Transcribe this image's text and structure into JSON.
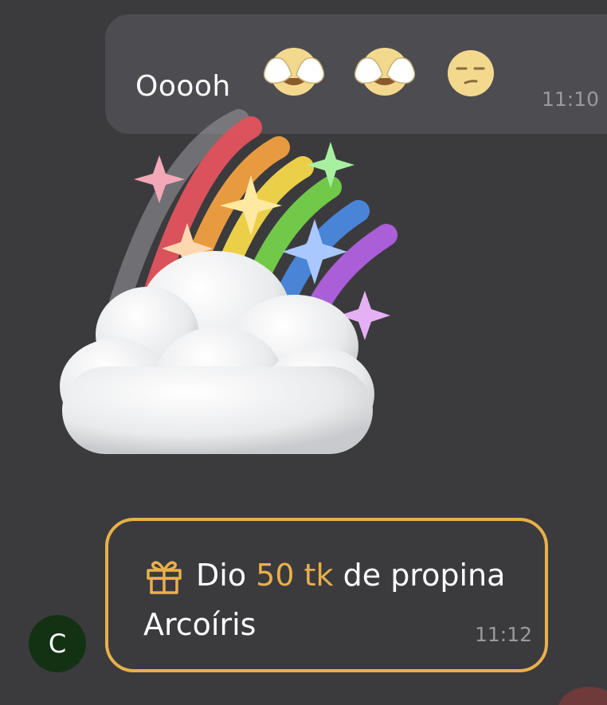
{
  "message_top": {
    "text": "Ooooh",
    "emojis": [
      "see-no-evil-face",
      "see-no-evil-face",
      "unamused-face"
    ],
    "time": "11:10"
  },
  "sticker": {
    "name": "cloud-rainbow-sticker"
  },
  "gift": {
    "prefix": "Dio",
    "amount": "50 tk",
    "suffix": "de propina",
    "name": "Arcoíris",
    "time": "11:12",
    "accent_color": "#e8b04a"
  },
  "avatar": {
    "initial": "C",
    "color": "#133214"
  }
}
